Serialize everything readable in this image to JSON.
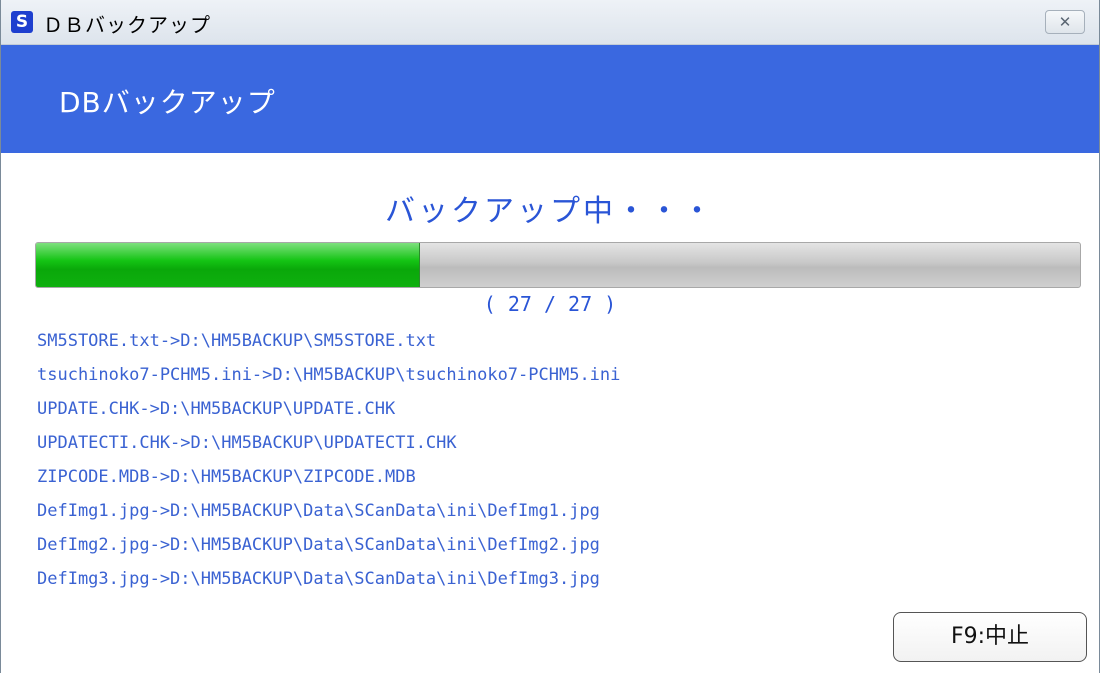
{
  "window": {
    "title": "ＤＢバックアップ",
    "icon_letter": "S",
    "close_icon": "close-icon",
    "close_glyph": "✕"
  },
  "header": {
    "title": "DBバックアップ",
    "color": "#3a68e0"
  },
  "status": {
    "text": "バックアップ中・・・"
  },
  "progress": {
    "fraction": 0.367,
    "count_text": "( 27 / 27 )"
  },
  "log": [
    "SM5STORE.txt->D:\\HM5BACKUP\\SM5STORE.txt",
    "tsuchinoko7-PCHM5.ini->D:\\HM5BACKUP\\tsuchinoko7-PCHM5.ini",
    "UPDATE.CHK->D:\\HM5BACKUP\\UPDATE.CHK",
    "UPDATECTI.CHK->D:\\HM5BACKUP\\UPDATECTI.CHK",
    "ZIPCODE.MDB->D:\\HM5BACKUP\\ZIPCODE.MDB",
    "DefImg1.jpg->D:\\HM5BACKUP\\Data\\SCanData\\ini\\DefImg1.jpg",
    "DefImg2.jpg->D:\\HM5BACKUP\\Data\\SCanData\\ini\\DefImg2.jpg",
    "DefImg3.jpg->D:\\HM5BACKUP\\Data\\SCanData\\ini\\DefImg3.jpg"
  ],
  "buttons": {
    "cancel_label": "F9:中止"
  }
}
